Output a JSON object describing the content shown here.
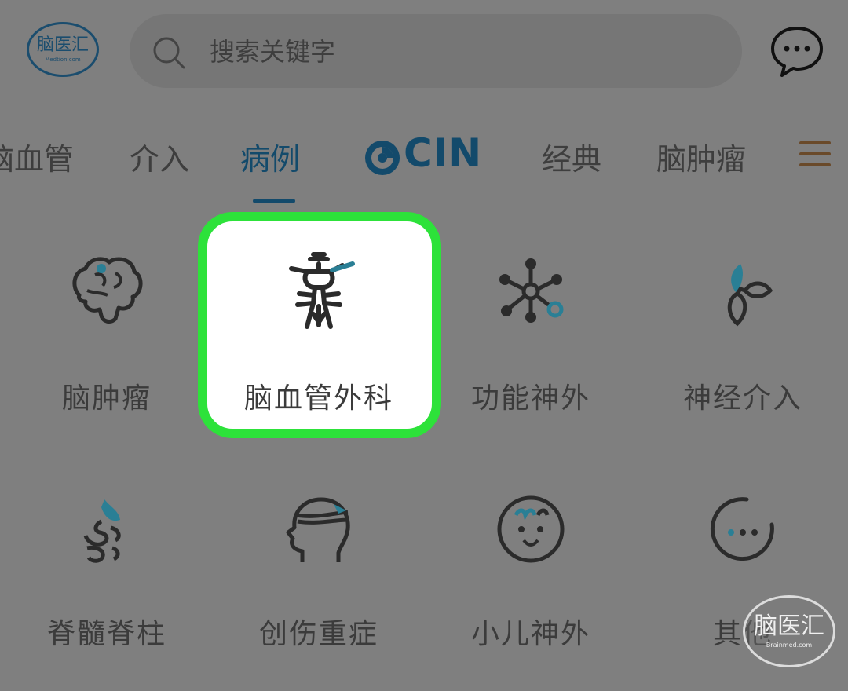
{
  "header": {
    "logo_text": "脑医汇",
    "logo_sub": "Medtion.com",
    "search_placeholder": "搜索关键字",
    "search_icon": "search-icon",
    "chat_icon": "chat-bubble-icon"
  },
  "tabs": {
    "items": [
      {
        "label": "脑血管"
      },
      {
        "label": "介入"
      },
      {
        "label": "病例"
      },
      {
        "label": "CIN"
      },
      {
        "label": "经典"
      },
      {
        "label": "脑肿瘤"
      }
    ],
    "active": "病例",
    "menu_icon": "menu-icon"
  },
  "categories": [
    {
      "label": "脑肿瘤",
      "icon": "brain-icon"
    },
    {
      "label": "脑血管外科",
      "icon": "cerebral-vessel-icon"
    },
    {
      "label": "功能神外",
      "icon": "network-node-icon"
    },
    {
      "label": "神经介入",
      "icon": "leaf-icon"
    },
    {
      "label": "脊髓脊柱",
      "icon": "spine-icon"
    },
    {
      "label": "创伤重症",
      "icon": "head-bandage-icon"
    },
    {
      "label": "小儿神外",
      "icon": "child-face-icon"
    },
    {
      "label": "其他",
      "icon": "more-dots-icon"
    }
  ],
  "highlighted_category": "脑血管外科",
  "watermark": {
    "text": "脑医汇",
    "sub": "Brainmed.com"
  },
  "colors": {
    "accent": "#134a6b",
    "teal": "#2a7f95",
    "highlight_border": "#2de23a",
    "overlay": "#7f7f7f"
  }
}
